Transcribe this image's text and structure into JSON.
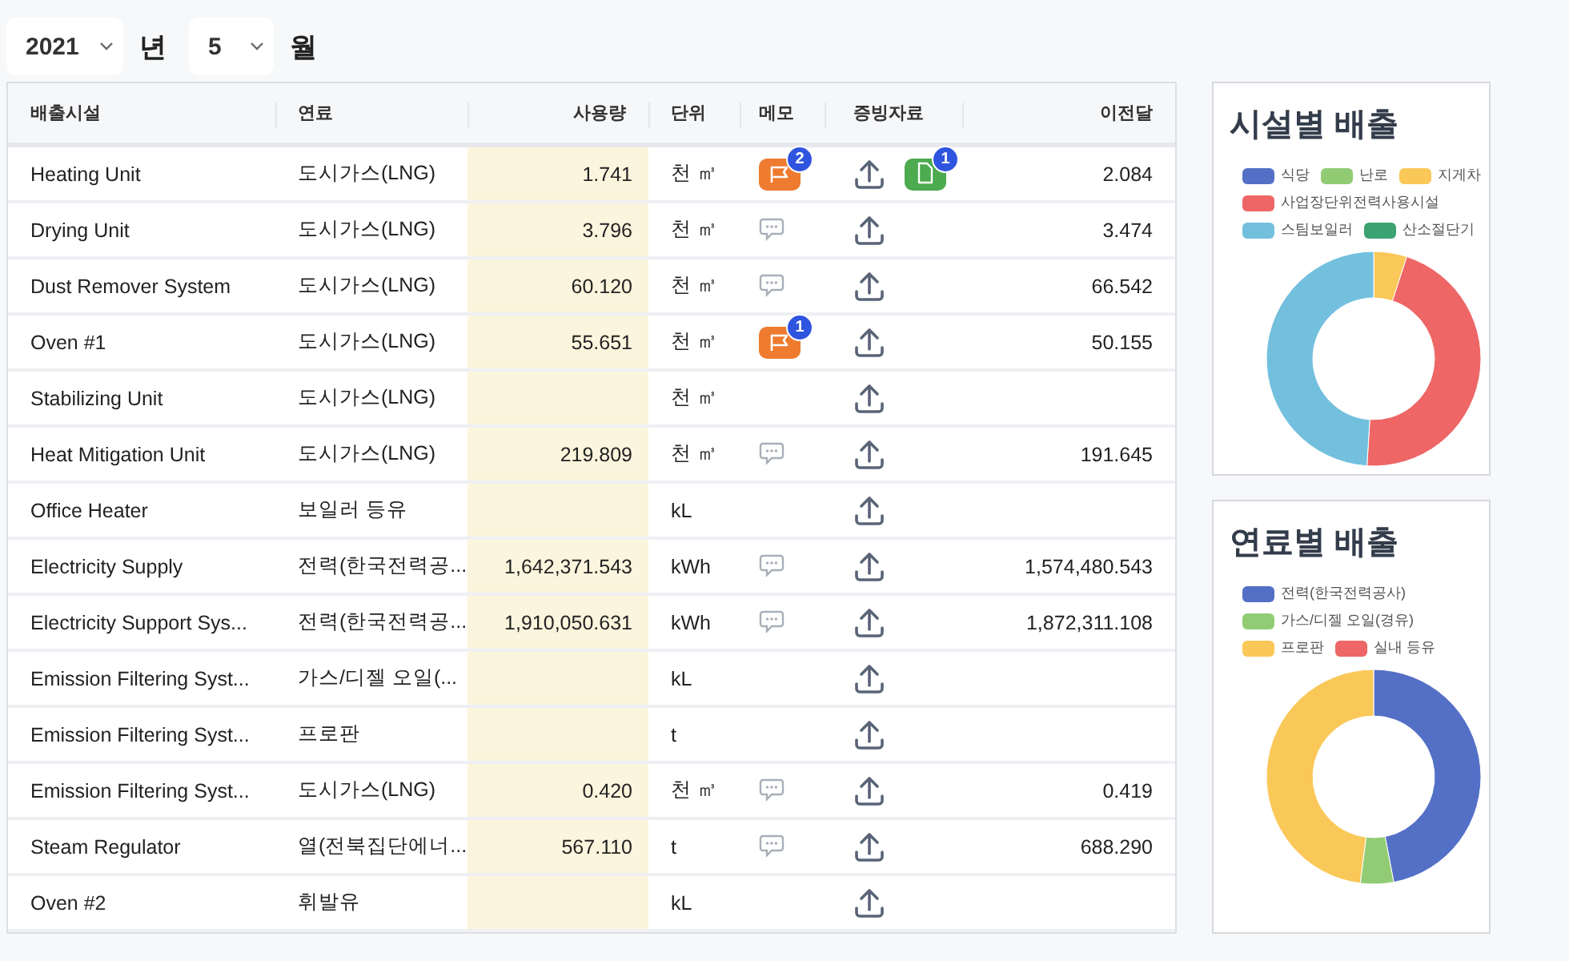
{
  "filters": {
    "year": "2021",
    "year_unit": "년",
    "month": "5",
    "month_unit": "월"
  },
  "table": {
    "columns": [
      "배출시설",
      "연료",
      "사용량",
      "단위",
      "메모",
      "증빙자료",
      "이전달"
    ],
    "rows": [
      {
        "facility": "Heating Unit",
        "fuel": "도시가스(LNG)",
        "usage": "1.741",
        "unit": "천 ㎥",
        "memo": {
          "kind": "flag",
          "count": "2"
        },
        "file_count": "1",
        "previous": "2.084"
      },
      {
        "facility": "Drying Unit",
        "fuel": "도시가스(LNG)",
        "usage": "3.796",
        "unit": "천 ㎥",
        "memo": {
          "kind": "comment"
        },
        "previous": "3.474"
      },
      {
        "facility": "Dust Remover System",
        "fuel": "도시가스(LNG)",
        "usage": "60.120",
        "unit": "천 ㎥",
        "memo": {
          "kind": "comment"
        },
        "previous": "66.542"
      },
      {
        "facility": "Oven #1",
        "fuel": "도시가스(LNG)",
        "usage": "55.651",
        "unit": "천 ㎥",
        "memo": {
          "kind": "flag",
          "count": "1"
        },
        "previous": "50.155"
      },
      {
        "facility": "Stabilizing Unit",
        "fuel": "도시가스(LNG)",
        "unit": "천 ㎥"
      },
      {
        "facility": "Heat Mitigation Unit",
        "fuel": "도시가스(LNG)",
        "usage": "219.809",
        "unit": "천 ㎥",
        "memo": {
          "kind": "comment"
        },
        "previous": "191.645"
      },
      {
        "facility": "Office Heater",
        "fuel": "보일러 등유",
        "unit": "kL"
      },
      {
        "facility": "Electricity Supply",
        "fuel": "전력(한국전력공...",
        "usage": "1,642,371.543",
        "unit": "kWh",
        "memo": {
          "kind": "comment"
        },
        "previous": "1,574,480.543"
      },
      {
        "facility": "Electricity Support Sys...",
        "fuel": "전력(한국전력공...",
        "usage": "1,910,050.631",
        "unit": "kWh",
        "memo": {
          "kind": "comment"
        },
        "previous": "1,872,311.108"
      },
      {
        "facility": "Emission Filtering Syst...",
        "fuel": "가스/디젤 오일(...",
        "unit": "kL"
      },
      {
        "facility": "Emission Filtering Syst...",
        "fuel": "프로판",
        "unit": "t"
      },
      {
        "facility": "Emission Filtering Syst...",
        "fuel": "도시가스(LNG)",
        "usage": "0.420",
        "unit": "천 ㎥",
        "memo": {
          "kind": "comment"
        },
        "previous": "0.419"
      },
      {
        "facility": "Steam Regulator",
        "fuel": "열(전북집단에너...",
        "usage": "567.110",
        "unit": "t",
        "memo": {
          "kind": "comment"
        },
        "previous": "688.290"
      },
      {
        "facility": "Oven #2",
        "fuel": "휘발유",
        "unit": "kL"
      }
    ]
  },
  "panels": [
    {
      "title": "시설별 배출",
      "legend": [
        {
          "label": "식당",
          "color": "#5470c6"
        },
        {
          "label": "난로",
          "color": "#91cc75"
        },
        {
          "label": "지게차",
          "color": "#fac858"
        },
        {
          "label": "사업장단위전력사용시설",
          "color": "#ee6666"
        },
        {
          "label": "스팀보일러",
          "color": "#73c0de"
        },
        {
          "label": "산소절단기",
          "color": "#3ba272"
        }
      ]
    },
    {
      "title": "연료별 배출",
      "legend": [
        {
          "label": "전력(한국전력공사)",
          "color": "#5470c6"
        },
        {
          "label": "가스/디젤 오일(경유)",
          "color": "#91cc75"
        },
        {
          "label": "프로판",
          "color": "#fac858"
        },
        {
          "label": "실내 등유",
          "color": "#ee6666"
        }
      ]
    }
  ]
}
